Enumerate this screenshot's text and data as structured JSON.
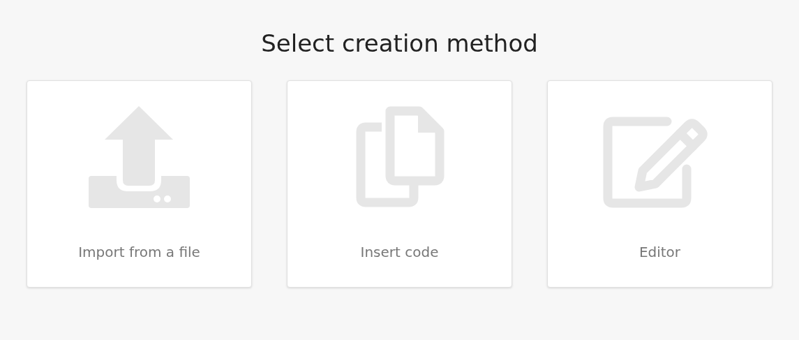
{
  "title": "Select creation method",
  "options": [
    {
      "kind": "upload",
      "label": "Import from a file"
    },
    {
      "kind": "copy",
      "label": "Insert code"
    },
    {
      "kind": "edit",
      "label": "Editor"
    }
  ]
}
